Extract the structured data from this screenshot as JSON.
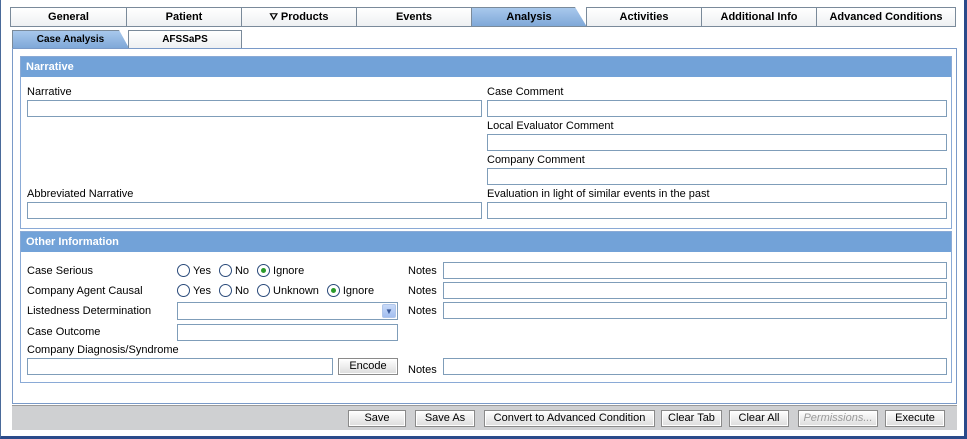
{
  "main_tabs": [
    {
      "label": "General"
    },
    {
      "label": "Patient"
    },
    {
      "label": "Products"
    },
    {
      "label": "Events"
    },
    {
      "label": "Analysis"
    },
    {
      "label": "Activities"
    },
    {
      "label": "Additional Info"
    },
    {
      "label": "Advanced Conditions"
    }
  ],
  "active_main_tab": "Analysis",
  "sub_tabs": [
    {
      "label": "Case Analysis"
    },
    {
      "label": "AFSSaPS"
    }
  ],
  "narrative_section": {
    "header": "Narrative",
    "narrative_label": "Narrative",
    "case_comment_label": "Case Comment",
    "local_evaluator_label": "Local Evaluator Comment",
    "company_comment_label": "Company Comment",
    "abbreviated_label": "Abbreviated Narrative",
    "evaluation_label": "Evaluation in light of similar events in the past"
  },
  "other_section": {
    "header": "Other Information",
    "case_serious_label": "Case Serious",
    "case_serious_options": [
      "Yes",
      "No",
      "Ignore"
    ],
    "case_serious_selected": "Ignore",
    "agent_causal_label": "Company Agent Causal",
    "agent_causal_options": [
      "Yes",
      "No",
      "Unknown",
      "Ignore"
    ],
    "agent_causal_selected": "Ignore",
    "listedness_label": "Listedness Determination",
    "listedness_value": "",
    "case_outcome_label": "Case Outcome",
    "diagnosis_label": "Company Diagnosis/Syndrome",
    "encode_label": "Encode",
    "notes_label": "Notes"
  },
  "footer": {
    "save": "Save",
    "save_as": "Save As",
    "convert": "Convert to Advanced Condition",
    "clear_tab": "Clear Tab",
    "clear_all": "Clear All",
    "permissions": "Permissions...",
    "execute": "Execute"
  },
  "colors": {
    "section_header": "#72a2d8",
    "active_tab": "#7fa8d8",
    "radio_dot": "#2a9a2a"
  }
}
